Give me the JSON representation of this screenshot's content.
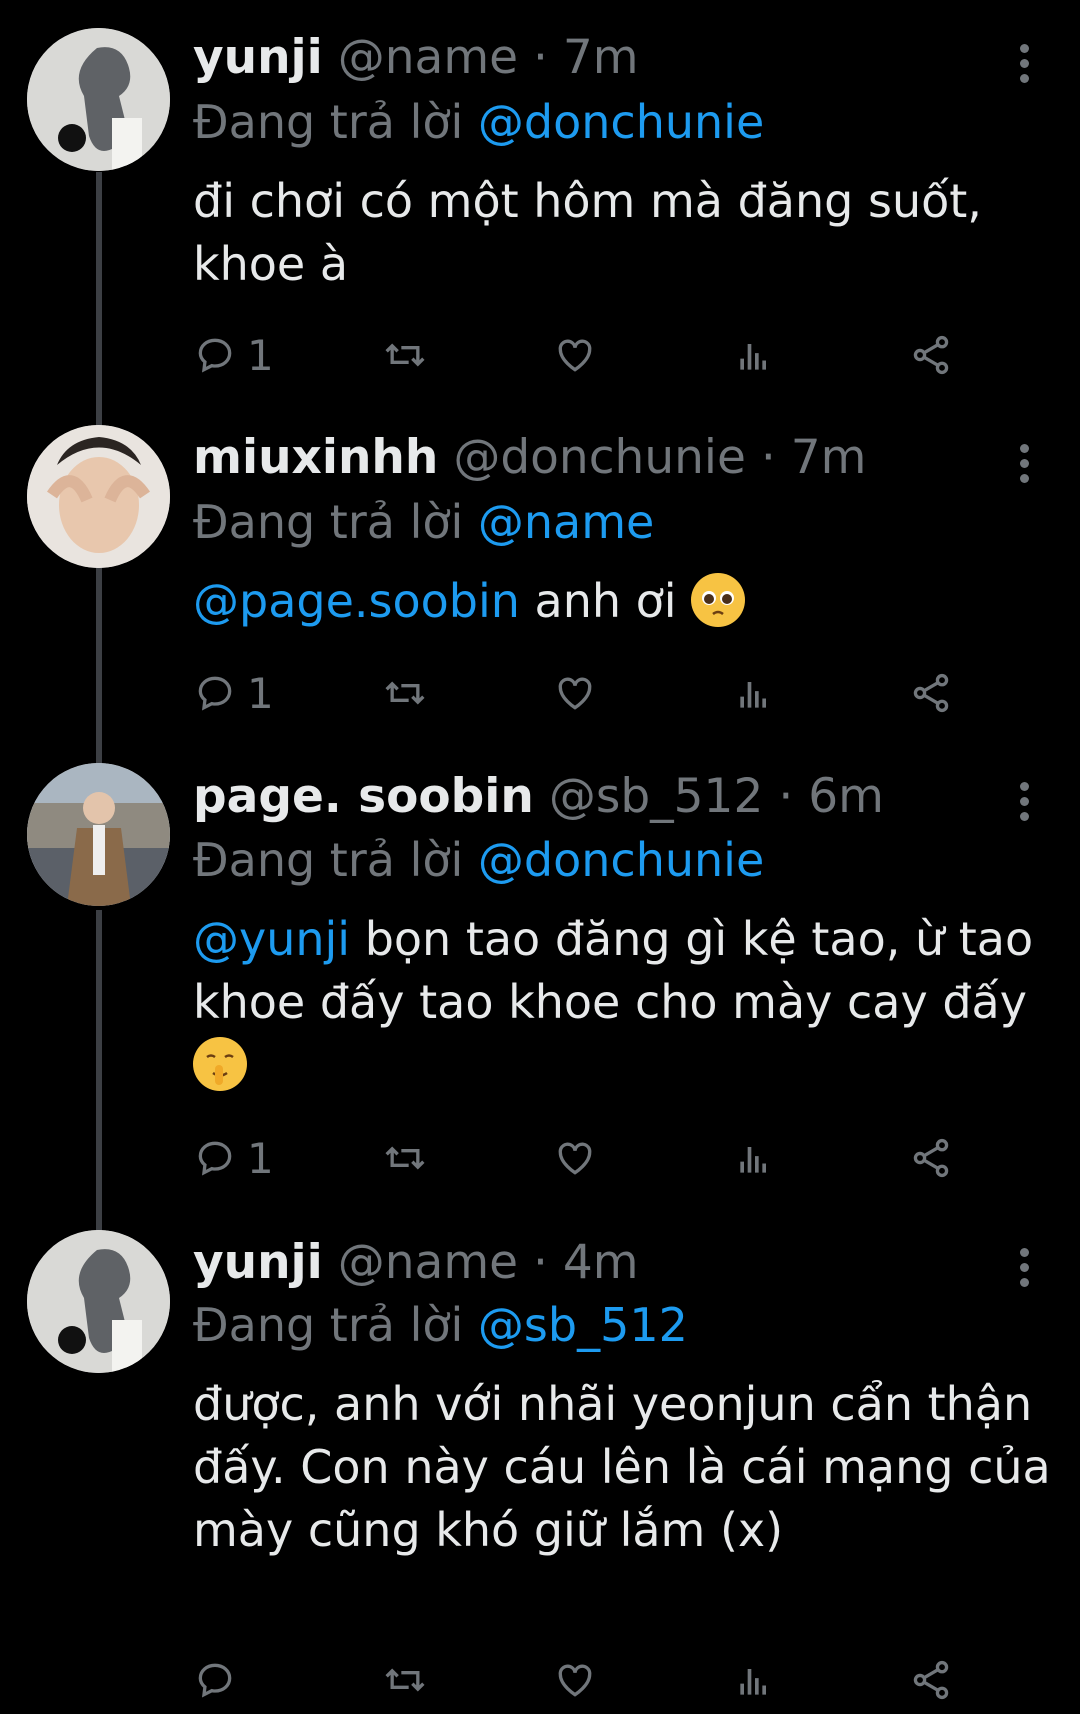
{
  "tweets": [
    {
      "name": "yunji",
      "handle": "@name",
      "time": "· 7m",
      "replying_prefix": "Đang trả lời",
      "replying_to": "@donchunie",
      "mention": "",
      "text": "đi chơi có một hôm mà đăng suốt, khoe à",
      "emoji": "",
      "reply_count": "1"
    },
    {
      "name": "miuxinhh",
      "handle": "@donchunie",
      "time": "· 7m",
      "replying_prefix": "Đang trả lời",
      "replying_to": "@name",
      "mention": "@page.soobin",
      "text": " anh ơi ",
      "emoji": "pleading-face",
      "reply_count": "1"
    },
    {
      "name": "page. soobin",
      "handle": "@sb_512",
      "time": "· 6m",
      "replying_prefix": "Đang trả lời",
      "replying_to": "@donchunie",
      "mention": "@yunji",
      "text": " bọn tao đăng gì kệ tao, ừ tao khoe đấy tao khoe cho mày cay đấy ",
      "emoji": "shushing-face",
      "reply_count": "1"
    },
    {
      "name": "yunji",
      "handle": "@name",
      "time": "· 4m",
      "replying_prefix": "Đang trả lời",
      "replying_to": "@sb_512",
      "mention": "",
      "text": "được, anh với nhãi yeonjun cẩn thận đấy. Con này cáu lên là cái mạng của mày cũng khó giữ lắm (x)",
      "emoji": "",
      "reply_count": ""
    }
  ],
  "icons": [
    "reply-icon",
    "retweet-icon",
    "like-icon",
    "views-icon",
    "share-icon",
    "more-icon"
  ],
  "colors": {
    "background": "#000000",
    "text": "#e7e9ea",
    "muted": "#71767b",
    "accent": "#1d9bf0"
  }
}
